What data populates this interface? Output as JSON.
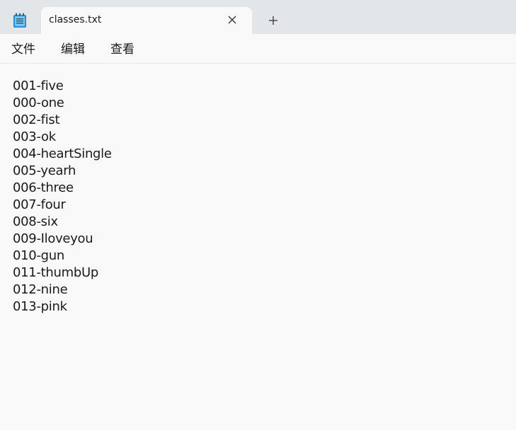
{
  "tab": {
    "title": "classes.txt"
  },
  "icons": {
    "app": "notepad-icon",
    "close": "close-icon",
    "new_tab": "plus-icon"
  },
  "menu": [
    "文件",
    "编辑",
    "查看"
  ],
  "lines": [
    "001-five",
    "000-one",
    "002-fist",
    "003-ok",
    "004-heartSingle",
    "005-yearh",
    "006-three",
    "007-four",
    "008-six",
    "009-Iloveyou",
    "010-gun",
    "011-thumbUp",
    "012-nine",
    "013-pink"
  ],
  "colors": {
    "titlebar": "#e3e6e8",
    "background": "#f9f9f9",
    "icon_blue": "#2f8ec9"
  }
}
